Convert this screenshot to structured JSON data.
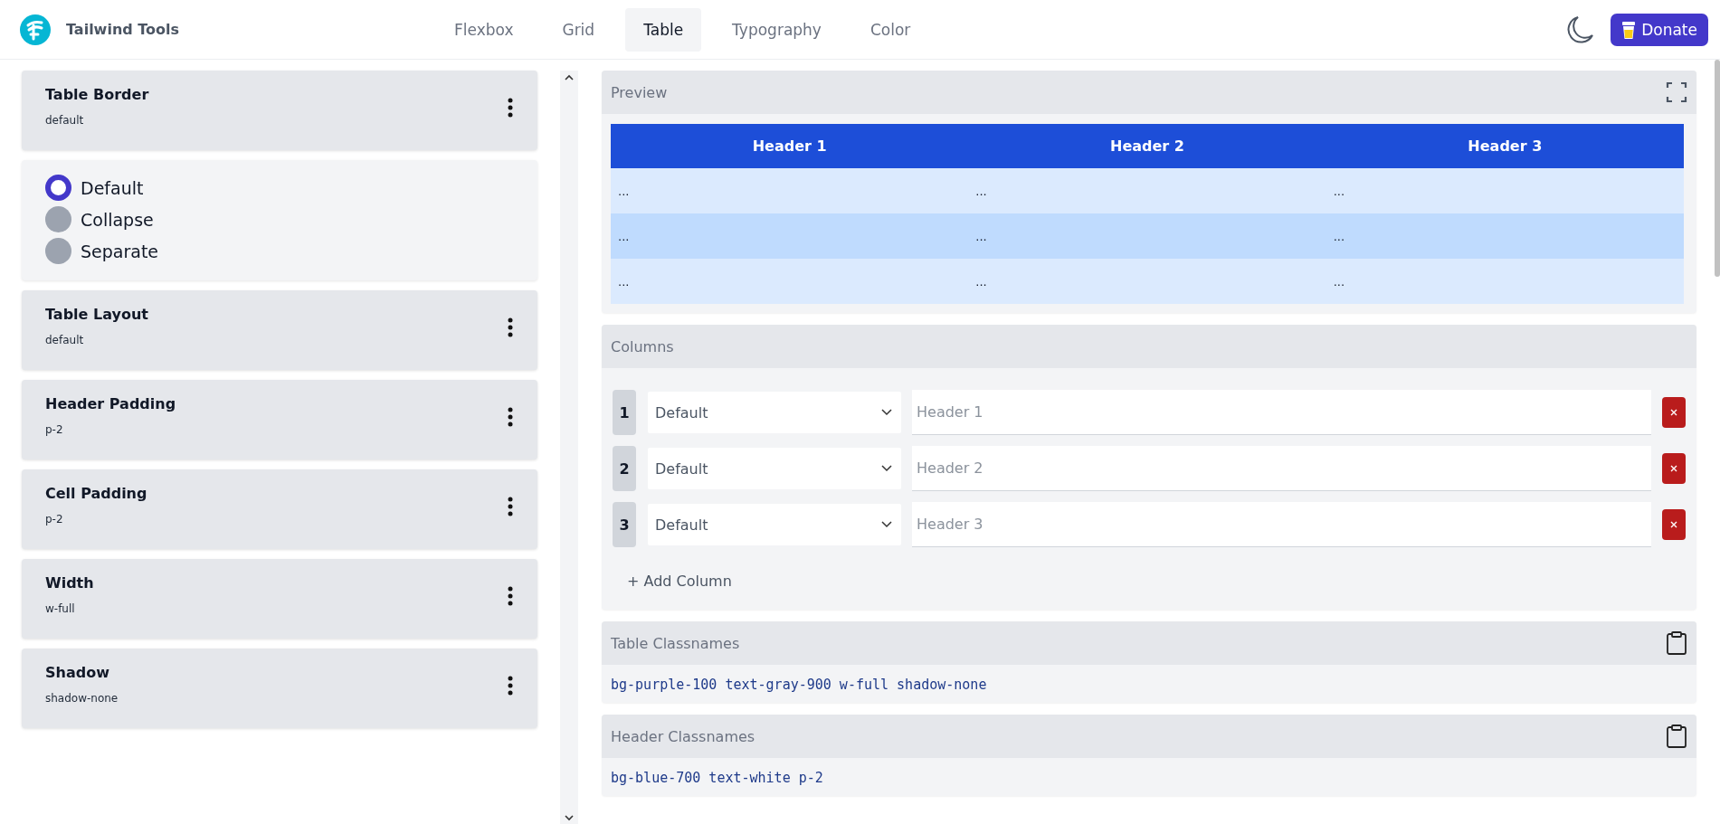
{
  "brand": {
    "name": "Tailwind Tools"
  },
  "nav_tabs": [
    {
      "label": "Flexbox",
      "selected": false
    },
    {
      "label": "Grid",
      "selected": false
    },
    {
      "label": "Table",
      "selected": true
    },
    {
      "label": "Typography",
      "selected": false
    },
    {
      "label": "Color",
      "selected": false
    }
  ],
  "donate_button": {
    "label": "Donate"
  },
  "settings": [
    {
      "kind": "setting",
      "title": "Table Border",
      "value": "default"
    },
    {
      "kind": "options",
      "options": [
        {
          "label": "Default",
          "selected": true
        },
        {
          "label": "Collapse",
          "selected": false
        },
        {
          "label": "Separate",
          "selected": false
        }
      ]
    },
    {
      "kind": "setting",
      "title": "Table Layout",
      "value": "default"
    },
    {
      "kind": "setting",
      "title": "Header Padding",
      "value": "p-2"
    },
    {
      "kind": "setting",
      "title": "Cell Padding",
      "value": "p-2"
    },
    {
      "kind": "setting",
      "title": "Width",
      "value": "w-full"
    },
    {
      "kind": "setting",
      "title": "Shadow",
      "value": "shadow-none"
    }
  ],
  "preview": {
    "title": "Preview",
    "headers": [
      "Header 1",
      "Header 2",
      "Header 3"
    ],
    "rows": [
      {
        "cells": [
          "...",
          "...",
          "..."
        ],
        "highlighted": false
      },
      {
        "cells": [
          "...",
          "...",
          "..."
        ],
        "highlighted": true
      },
      {
        "cells": [
          "...",
          "...",
          "..."
        ],
        "highlighted": false
      }
    ]
  },
  "columns_panel": {
    "title": "Columns",
    "columns": [
      {
        "number": "1",
        "align": "Default",
        "placeholder": "Header 1"
      },
      {
        "number": "2",
        "align": "Default",
        "placeholder": "Header 2"
      },
      {
        "number": "3",
        "align": "Default",
        "placeholder": "Header 3"
      }
    ],
    "add_button": "+ Add Column"
  },
  "classname_panels": [
    {
      "title": "Table Classnames",
      "code": "bg-purple-100 text-gray-900 w-full shadow-none"
    },
    {
      "title": "Header Classnames",
      "code": "bg-blue-700 text-white p-2"
    }
  ]
}
